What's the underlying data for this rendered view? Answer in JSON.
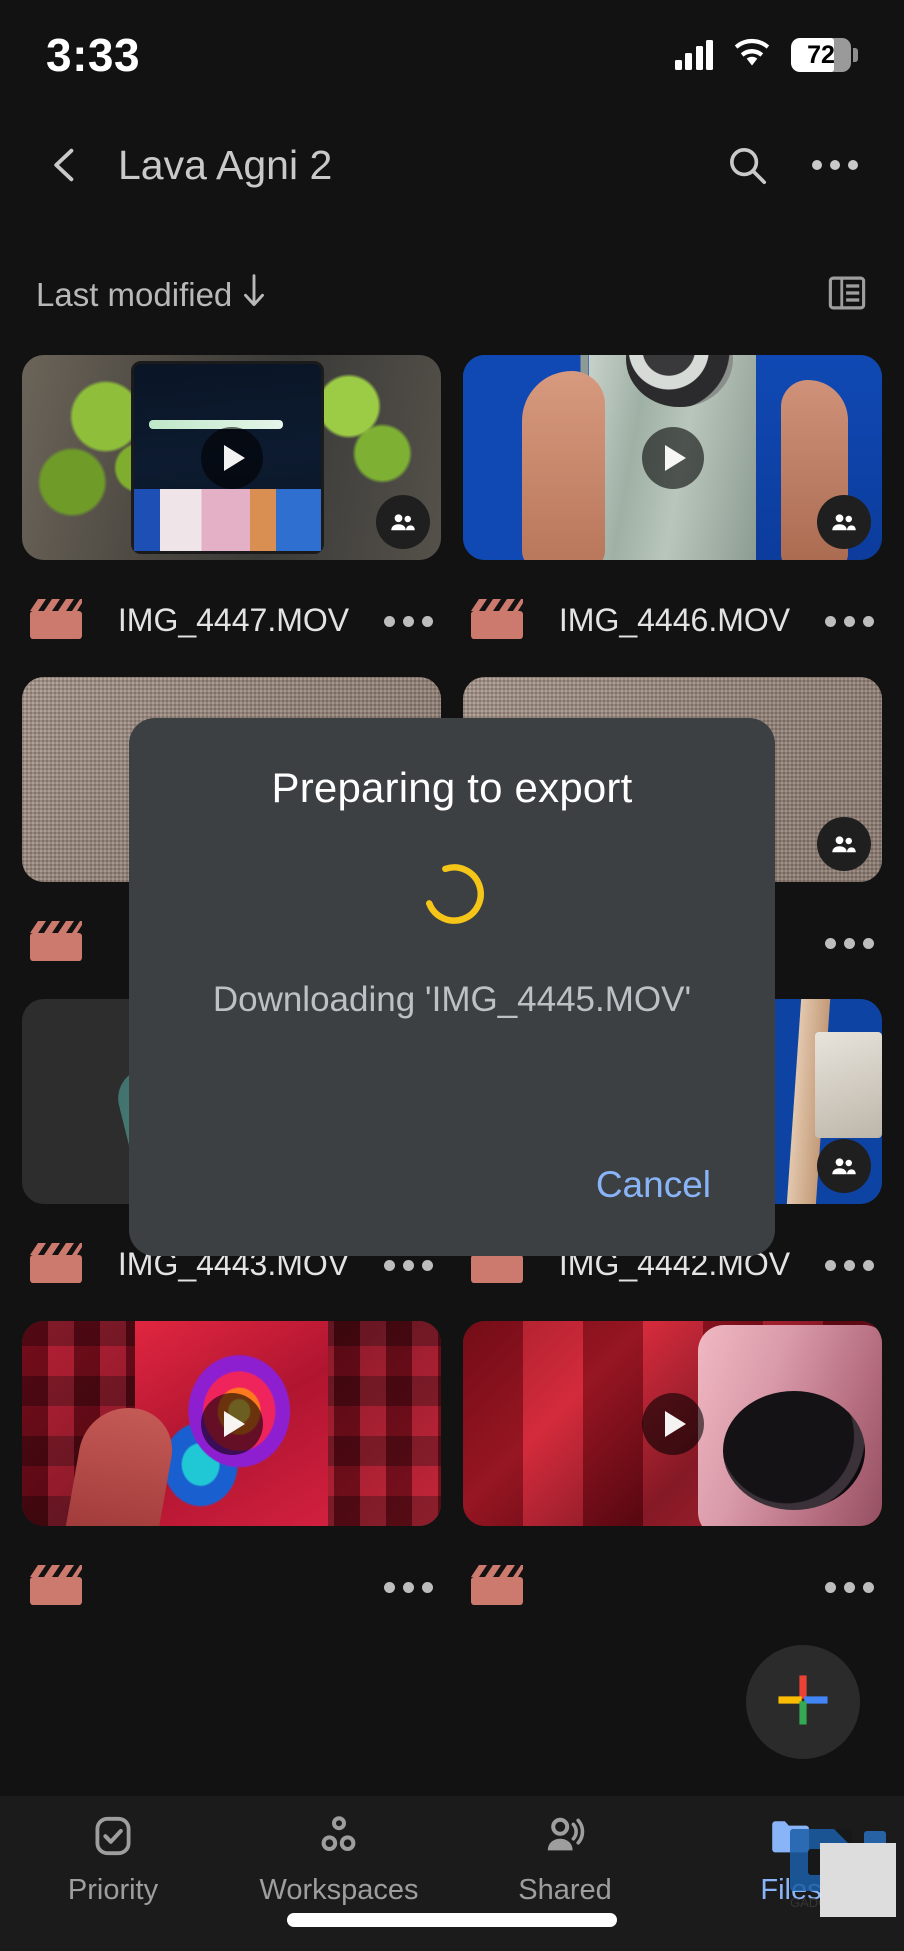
{
  "status_bar": {
    "time": "3:33",
    "battery_percent": "72",
    "signal_icon": "signal-bars-icon",
    "wifi_icon": "wifi-icon",
    "battery_icon": "battery-icon"
  },
  "app_bar": {
    "back_icon": "back-chevron-icon",
    "title": "Lava Agni 2",
    "search_icon": "search-icon",
    "overflow_icon": "more-vertical-icon"
  },
  "sort_bar": {
    "label": "Last modified",
    "direction_icon": "arrow-down-icon",
    "view_toggle_icon": "list-view-icon"
  },
  "files": [
    {
      "name": "IMG_4447.MOV",
      "type_icon": "clapperboard-icon",
      "badge_icon": "shared-people-icon",
      "play_icon": "play-icon",
      "more_icon": "more-horizontal-icon",
      "art": "art-4447"
    },
    {
      "name": "IMG_4446.MOV",
      "type_icon": "clapperboard-icon",
      "badge_icon": "shared-people-icon",
      "play_icon": "play-icon",
      "more_icon": "more-horizontal-icon",
      "art": "art-4446"
    },
    {
      "name": "",
      "type_icon": "clapperboard-icon",
      "badge_icon": "shared-people-icon",
      "play_icon": "play-icon",
      "more_icon": "more-horizontal-icon",
      "art": "art-fabric"
    },
    {
      "name": "",
      "type_icon": "clapperboard-icon",
      "badge_icon": "shared-people-icon",
      "play_icon": "play-icon",
      "more_icon": "more-horizontal-icon",
      "art": "art-fabric"
    },
    {
      "name": "IMG_4443.MOV",
      "type_icon": "clapperboard-icon",
      "badge_icon": "shared-people-icon",
      "play_icon": "play-icon",
      "more_icon": "more-horizontal-icon",
      "art": "art-4443"
    },
    {
      "name": "IMG_4442.MOV",
      "type_icon": "clapperboard-icon",
      "badge_icon": "shared-people-icon",
      "play_icon": "play-icon",
      "more_icon": "more-horizontal-icon",
      "art": "art-4442"
    },
    {
      "name": "",
      "type_icon": "clapperboard-icon",
      "badge_icon": "",
      "play_icon": "play-icon",
      "more_icon": "more-horizontal-icon",
      "art": "art-red1"
    },
    {
      "name": "",
      "type_icon": "clapperboard-icon",
      "badge_icon": "",
      "play_icon": "play-icon",
      "more_icon": "more-horizontal-icon",
      "art": "art-red2"
    }
  ],
  "fab": {
    "icon": "plus-icon",
    "colors": {
      "top": "#ea4335",
      "left": "#fbbc04",
      "right": "#4285f4",
      "bottom": "#34a853"
    }
  },
  "dialog": {
    "title": "Preparing to export",
    "spinner_icon": "loading-spinner-icon",
    "spinner_color": "#f5c518",
    "message": "Downloading 'IMG_4445.MOV'",
    "cancel_label": "Cancel",
    "cancel_color": "#8ab4f8",
    "background": "#3c4043"
  },
  "bottom_nav": {
    "items": [
      {
        "label": "Priority",
        "icon": "check-badge-icon",
        "active": false
      },
      {
        "label": "Workspaces",
        "icon": "workspaces-circles-icon",
        "active": false
      },
      {
        "label": "Shared",
        "icon": "shared-people-icon",
        "active": false
      },
      {
        "label": "Files",
        "icon": "folder-icon",
        "active": true
      }
    ],
    "active_color": "#8ab4f8",
    "inactive_color": "#9e9e9e"
  },
  "watermark": {
    "icon": "blue-logo-watermark"
  }
}
